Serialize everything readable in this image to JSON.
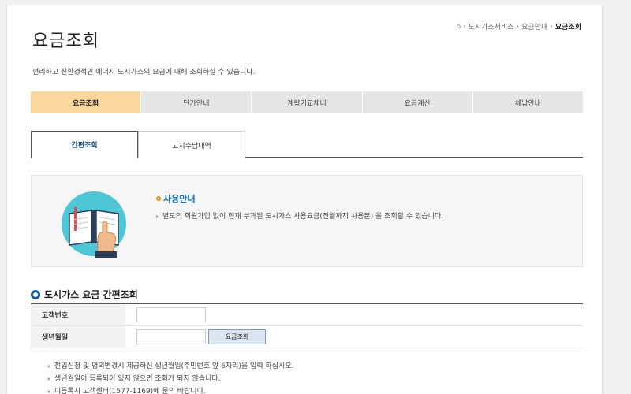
{
  "page": {
    "title": "요금조회",
    "description": "편리하고 친환경적인 에너지 도시가스의 요금에 대해 조회하실 수 있습니다."
  },
  "breadcrumb": {
    "home_icon": "home-icon",
    "items": [
      "도시가스서비스",
      "요금안내",
      "요금조회"
    ]
  },
  "main_nav": {
    "items": [
      "요금조회",
      "단가안내",
      "계량기교체비",
      "요금계산",
      "체납안내"
    ],
    "active_index": 0
  },
  "sub_tabs": {
    "items": [
      "간편조회",
      "고지수납내역"
    ],
    "active_index": 0
  },
  "info_box": {
    "illustration": "book-hand-icon",
    "title": "사용안내",
    "text": "별도의 회원가입 없이 현재 부과된 도시가스 사용요금(전월까지 사용분) 을 조회할 수 있습니다."
  },
  "form": {
    "section_title": "도시가스 요금 간편조회",
    "customer_no_label": "고객번호",
    "customer_no_value": "",
    "birthdate_label": "생년월일",
    "birthdate_value": "",
    "search_button": "요금조회"
  },
  "notes": [
    "전입신청 및 명의변경시 제공하신 생년월일(주민번호 앞 6자리)을 입력 하십시오.",
    "생년월일이 등록되어 있지 않으면 조회가 되지 않습니다.",
    "미등록시 고객센터(1577-1169)에 문의 바랍니다."
  ],
  "colors": {
    "active_nav": "#f9d79e",
    "accent_blue": "#1a6ea8",
    "info_dot": "#e89420",
    "button_bg": "#dce6f1"
  }
}
